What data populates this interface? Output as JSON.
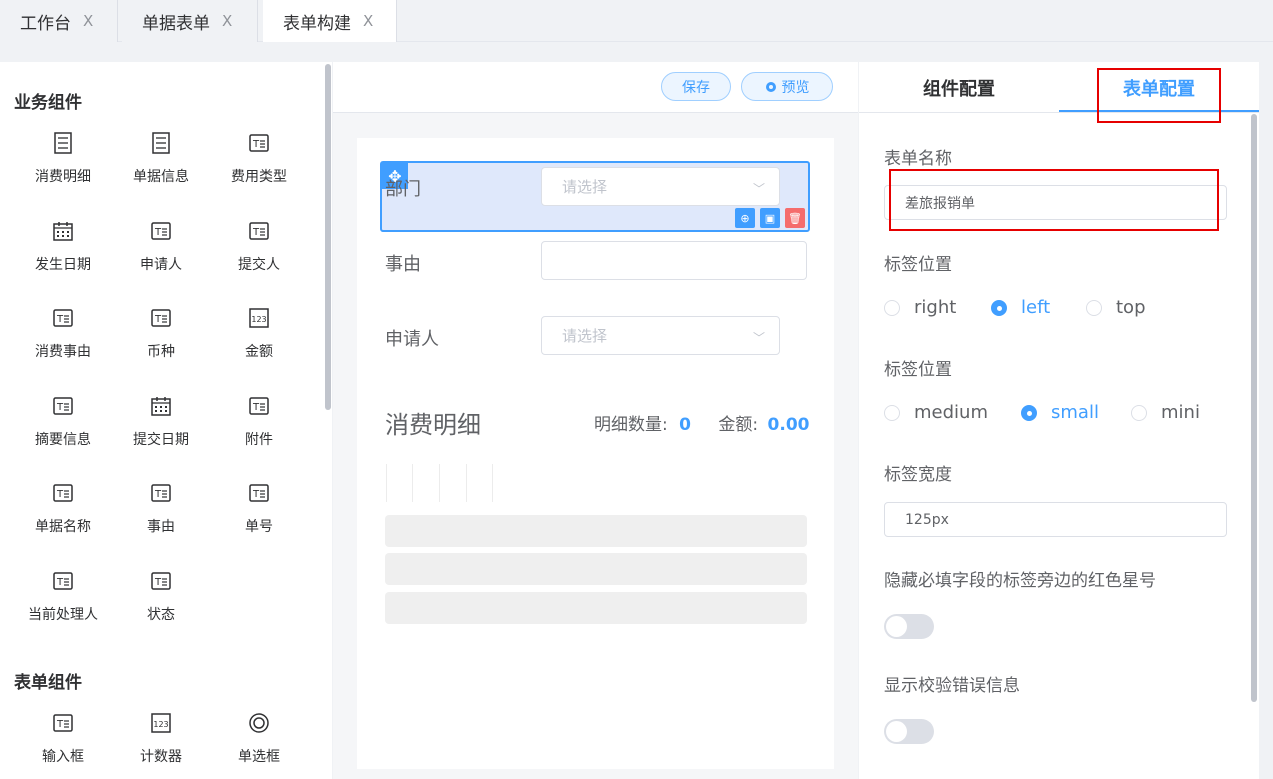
{
  "tabs": [
    {
      "label": "工作台",
      "close": "X"
    },
    {
      "label": "单据表单",
      "close": "X"
    },
    {
      "label": "表单构建",
      "close": "X"
    }
  ],
  "left_panel": {
    "business_title": "业务组件",
    "business_items": [
      {
        "label": "消费明细",
        "icon": "list-doc-icon"
      },
      {
        "label": "单据信息",
        "icon": "list-doc-icon"
      },
      {
        "label": "费用类型",
        "icon": "text-field-icon"
      },
      {
        "label": "发生日期",
        "icon": "calendar-icon"
      },
      {
        "label": "申请人",
        "icon": "text-field-icon"
      },
      {
        "label": "提交人",
        "icon": "text-field-icon"
      },
      {
        "label": "消费事由",
        "icon": "text-field-icon"
      },
      {
        "label": "币种",
        "icon": "text-field-icon"
      },
      {
        "label": "金额",
        "icon": "number-icon"
      },
      {
        "label": "摘要信息",
        "icon": "text-field-icon"
      },
      {
        "label": "提交日期",
        "icon": "calendar-icon"
      },
      {
        "label": "附件",
        "icon": "text-field-icon"
      },
      {
        "label": "单据名称",
        "icon": "text-field-icon"
      },
      {
        "label": "事由",
        "icon": "text-field-icon"
      },
      {
        "label": "单号",
        "icon": "text-field-icon"
      },
      {
        "label": "当前处理人",
        "icon": "text-field-icon"
      },
      {
        "label": "状态",
        "icon": "text-field-icon"
      }
    ],
    "form_title": "表单组件",
    "form_items": [
      {
        "label": "输入框",
        "icon": "text-field-icon"
      },
      {
        "label": "计数器",
        "icon": "number-icon"
      },
      {
        "label": "单选框",
        "icon": "radio-icon"
      }
    ]
  },
  "toolbar": {
    "save": "保存",
    "preview": "预览"
  },
  "canvas": {
    "dept_label": "部门",
    "dept_placeholder": "请选择",
    "reason_label": "事由",
    "applicant_label": "申请人",
    "applicant_placeholder": "请选择",
    "detail_title": "消费明细",
    "detail_count_label": "明细数量:",
    "detail_count": "0",
    "amount_label": "金额:",
    "amount_value": "0.00"
  },
  "right_panel": {
    "tab_component": "组件配置",
    "tab_form": "表单配置",
    "form_name_label": "表单名称",
    "form_name_value": "差旅报销单",
    "label_position_title": "标签位置",
    "label_position_options": [
      "right",
      "left",
      "top"
    ],
    "label_position_selected": "left",
    "size_title": "标签位置",
    "size_options": [
      "medium",
      "small",
      "mini"
    ],
    "size_selected": "small",
    "label_width_title": "标签宽度",
    "label_width_value": "125px",
    "hide_required_title": "隐藏必填字段的标签旁边的红色星号",
    "hide_required_on": false,
    "show_error_title": "显示校验错误信息",
    "show_error_on": false
  },
  "colors": {
    "accent": "#409eff",
    "highlight": "#e60000",
    "delete": "#f56c6c"
  }
}
